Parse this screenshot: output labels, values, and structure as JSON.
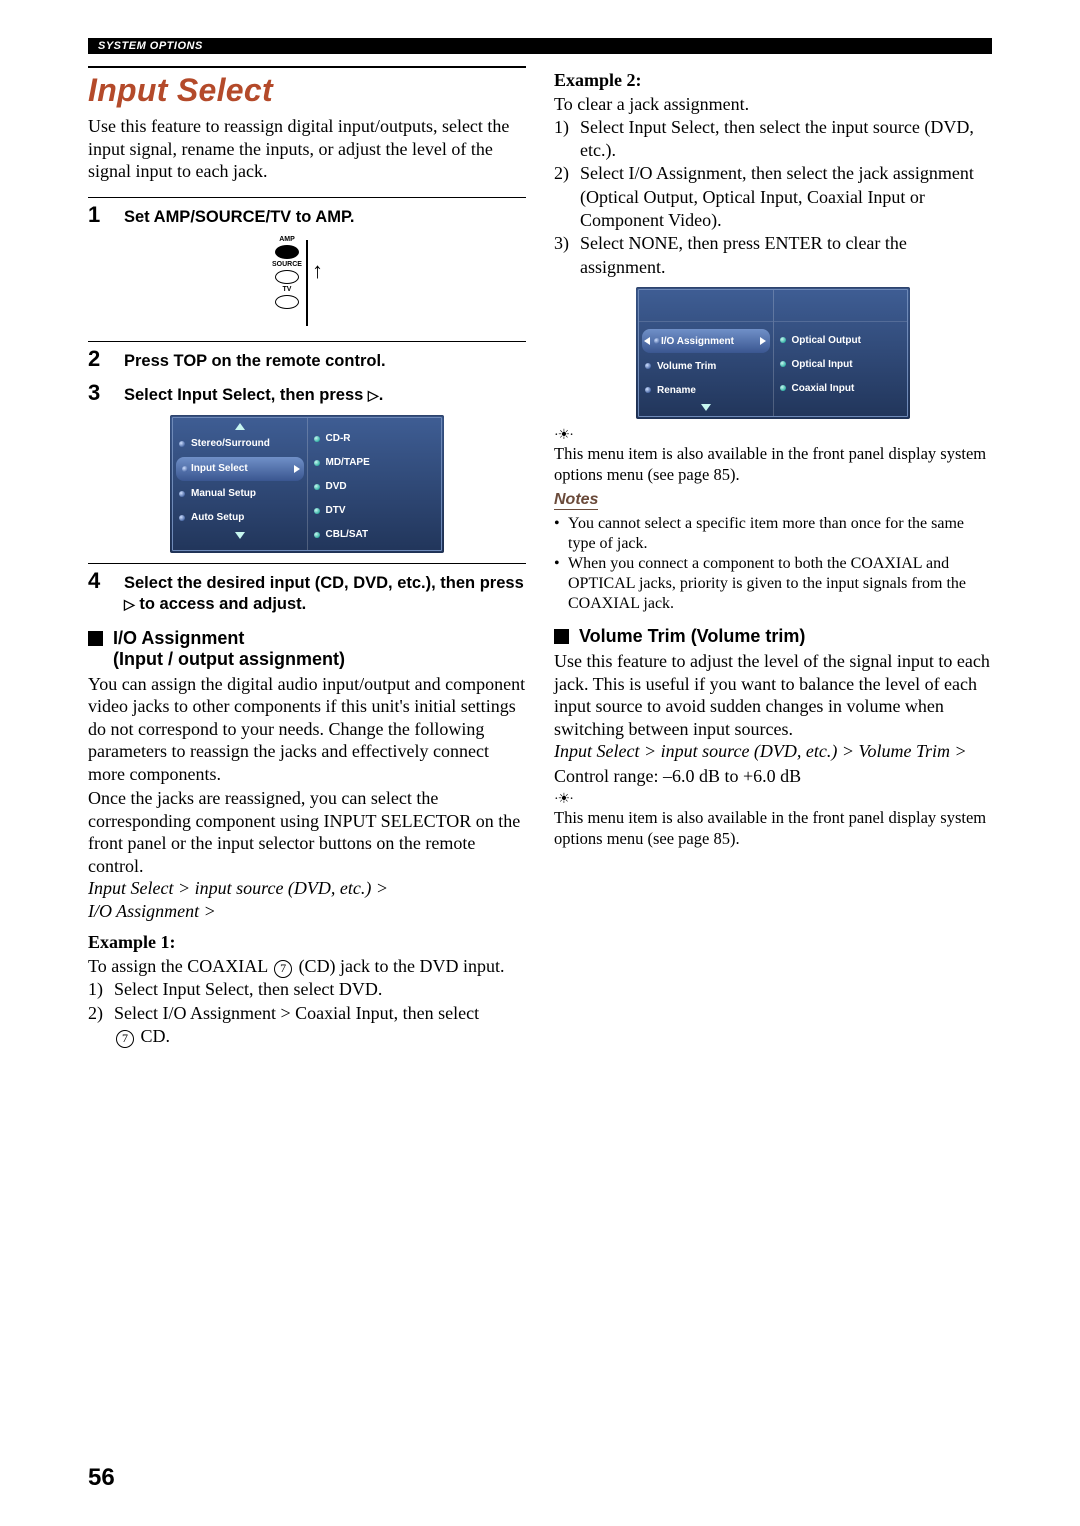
{
  "header": {
    "label": "SYSTEM OPTIONS"
  },
  "title": "Input Select",
  "intro": "Use this feature to reassign digital input/outputs, select the input signal, rename the inputs, or adjust the level of the signal input to each jack.",
  "steps": {
    "s1": {
      "num": "1",
      "text": "Set AMP/SOURCE/TV to AMP."
    },
    "s2": {
      "num": "2",
      "text": "Press TOP on the remote control."
    },
    "s3": {
      "num": "3",
      "text_a": "Select Input Select, then press ",
      "text_b": "."
    },
    "s4": {
      "num": "4",
      "text_a": "Select the desired input (CD, DVD, etc.), then press ",
      "text_b": " to access and adjust."
    }
  },
  "switch": {
    "l1": "AMP",
    "l2": "SOURCE",
    "l3": "TV"
  },
  "osd1": {
    "left": [
      "Stereo/Surround",
      "Input Select",
      "Manual Setup",
      "Auto Setup"
    ],
    "right": [
      "CD-R",
      "MD/TAPE",
      "DVD",
      "DTV",
      "CBL/SAT"
    ]
  },
  "io": {
    "head1": "I/O Assignment",
    "head2": "(Input / output assignment)",
    "body1": "You can assign the digital audio input/output and component video jacks to other components if this unit's initial settings do not correspond to your needs. Change the following parameters to reassign the jacks and effectively connect more components.",
    "body2": "Once the jacks are reassigned, you can select the corresponding component using INPUT SELECTOR on the front panel or the input selector buttons on the remote control.",
    "path1": "Input Select > input source (DVD, etc.) >",
    "path2": "I/O Assignment >",
    "ex1_label": "Example 1:",
    "ex1_intro_a": "To assign the COAXIAL ",
    "ex1_intro_b": " (CD) jack to the DVD input.",
    "ex1_1": "Select Input Select, then select DVD.",
    "ex1_2a": "Select I/O Assignment > Coaxial Input, then select ",
    "ex1_2b": " CD."
  },
  "right": {
    "ex2_label": "Example 2:",
    "ex2_intro": "To clear a jack assignment.",
    "ex2_1": "Select Input Select, then select the input source (DVD, etc.).",
    "ex2_2": "Select I/O Assignment, then select the jack assignment (Optical Output, Optical Input, Coaxial Input or Component Video).",
    "ex2_3": "Select NONE, then press ENTER to clear the assignment.",
    "osd2": {
      "left": [
        "I/O Assignment",
        "Volume Trim",
        "Rename"
      ],
      "right": [
        "Optical Output",
        "Optical Input",
        "Coaxial Input"
      ]
    },
    "tip1": "This menu item is also available in the front panel display system options menu (see page 85).",
    "notes_label": "Notes",
    "note1": "You cannot select a specific item more than once for the same type of jack.",
    "note2": "When you connect a component to both the COAXIAL and OPTICAL jacks, priority is given to the input signals from the COAXIAL jack.",
    "vol_head": "Volume Trim (Volume trim)",
    "vol_body": "Use this feature to adjust the level of the signal input to each jack. This is useful if you want to balance the level of each input source to avoid sudden changes in volume when switching between input sources.",
    "vol_path": "Input Select > input source (DVD, etc.) > Volume Trim >",
    "vol_range": "Control range: –6.0 dB to +6.0 dB",
    "tip2": "This menu item is also available in the front panel display system options menu (see page 85)."
  },
  "pagenum": "56"
}
